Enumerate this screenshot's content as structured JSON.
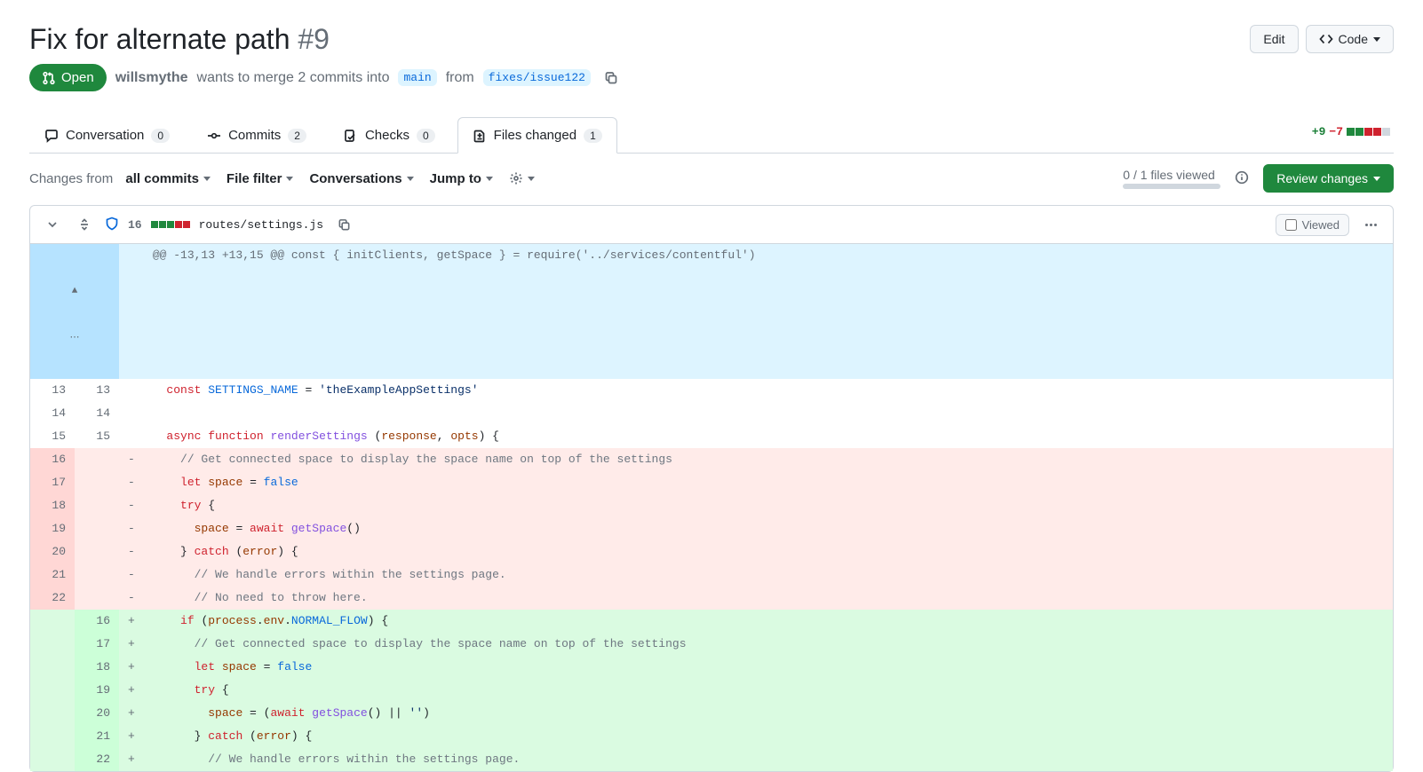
{
  "title": {
    "text": "Fix for alternate path",
    "number": "#9"
  },
  "actions": {
    "edit": "Edit",
    "code": "Code"
  },
  "state": "Open",
  "meta": {
    "author": "willsmythe",
    "verb": "wants to merge 2 commits into",
    "base": "main",
    "from_word": "from",
    "head": "fixes/issue122"
  },
  "tabs": {
    "conversation": {
      "label": "Conversation",
      "count": "0"
    },
    "commits": {
      "label": "Commits",
      "count": "2"
    },
    "checks": {
      "label": "Checks",
      "count": "0"
    },
    "files": {
      "label": "Files changed",
      "count": "1"
    }
  },
  "diffstat": {
    "add": "+9",
    "del": "−7"
  },
  "toolbar": {
    "changes_from": "Changes from",
    "all_commits": "all commits",
    "file_filter": "File filter",
    "conversations": "Conversations",
    "jump_to": "Jump to",
    "viewed_count": "0 / 1 files viewed",
    "review_changes": "Review changes"
  },
  "file": {
    "lines": "16",
    "path": "routes/settings.js",
    "viewed": "Viewed"
  },
  "hunk": "@@ -13,13 +13,15 @@ const { initClients, getSpace } = require('../services/contentful')",
  "lines": [
    {
      "type": "ctx",
      "ol": "13",
      "nl": "13",
      "m": " ",
      "html": "<span class='k'>const</span> <span class='b'>SETTINGS_NAME</span> = <span class='s'>'theExampleAppSettings'</span>"
    },
    {
      "type": "ctx",
      "ol": "14",
      "nl": "14",
      "m": " ",
      "html": ""
    },
    {
      "type": "ctx",
      "ol": "15",
      "nl": "15",
      "m": " ",
      "html": "<span class='k'>async</span> <span class='k'>function</span> <span class='f'>renderSettings</span> (<span class='v'>response</span>, <span class='v'>opts</span>) {"
    },
    {
      "type": "del",
      "ol": "16",
      "nl": "",
      "m": "-",
      "html": "  <span class='c'>// Get connected space to display the space name on top of the settings</span>"
    },
    {
      "type": "del",
      "ol": "17",
      "nl": "",
      "m": "-",
      "html": "  <span class='k'>let</span> <span class='v'>space</span> = <span class='b'>false</span>"
    },
    {
      "type": "del",
      "ol": "18",
      "nl": "",
      "m": "-",
      "html": "  <span class='k'>try</span> {"
    },
    {
      "type": "del",
      "ol": "19",
      "nl": "",
      "m": "-",
      "html": "    <span class='v'>space</span> = <span class='k'>await</span> <span class='f'>getSpace</span>()"
    },
    {
      "type": "del",
      "ol": "20",
      "nl": "",
      "m": "-",
      "html": "  } <span class='k'>catch</span> (<span class='v'>error</span>) {"
    },
    {
      "type": "del",
      "ol": "21",
      "nl": "",
      "m": "-",
      "html": "    <span class='c'>// We handle errors within the settings page.</span>"
    },
    {
      "type": "del",
      "ol": "22",
      "nl": "",
      "m": "-",
      "html": "    <span class='c'>// No need to throw here.</span>"
    },
    {
      "type": "add",
      "ol": "",
      "nl": "16",
      "m": "+",
      "html": "  <span class='k'>if</span> (<span class='v'>process</span>.<span class='v'>env</span>.<span class='b'>NORMAL_FLOW</span>) {"
    },
    {
      "type": "add",
      "ol": "",
      "nl": "17",
      "m": "+",
      "html": "    <span class='c'>// Get connected space to display the space name on top of the settings</span>"
    },
    {
      "type": "add",
      "ol": "",
      "nl": "18",
      "m": "+",
      "html": "    <span class='k'>let</span> <span class='v'>space</span> = <span class='b'>false</span>"
    },
    {
      "type": "add",
      "ol": "",
      "nl": "19",
      "m": "+",
      "html": "    <span class='k'>try</span> {"
    },
    {
      "type": "add",
      "ol": "",
      "nl": "20",
      "m": "+",
      "html": "      <span class='v'>space</span> = (<span class='k'>await</span> <span class='f'>getSpace</span>() || <span class='s'>''</span>)"
    },
    {
      "type": "add",
      "ol": "",
      "nl": "21",
      "m": "+",
      "html": "    } <span class='k'>catch</span> (<span class='v'>error</span>) {"
    },
    {
      "type": "add",
      "ol": "",
      "nl": "22",
      "m": "+",
      "html": "      <span class='c'>// We handle errors within the settings page.</span>"
    }
  ]
}
